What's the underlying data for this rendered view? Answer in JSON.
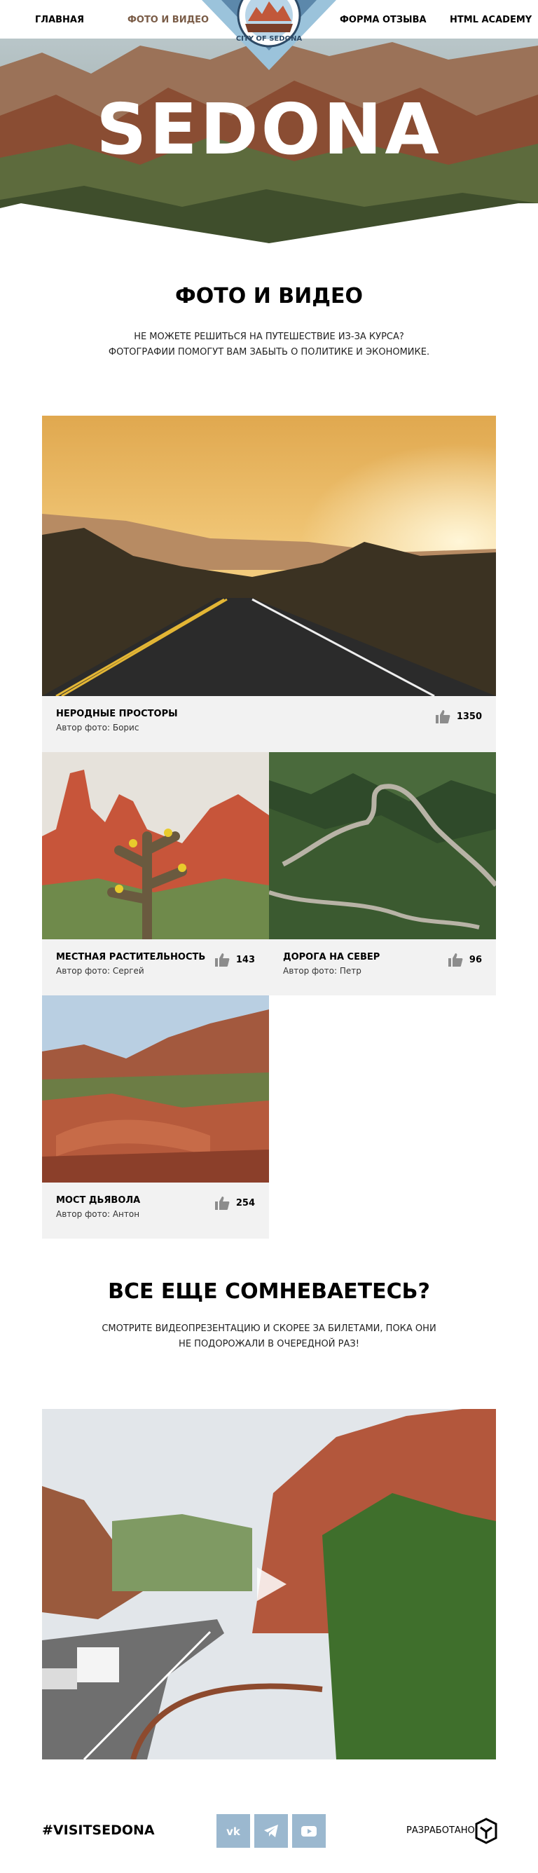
{
  "nav": {
    "main": "ГЛАВНАЯ",
    "photo": "ФОТО И ВИДЕО",
    "form": "ФОРМА ОТЗЫВА",
    "academy": "HTML ACADEMY"
  },
  "logo": {
    "text": "CITY OF SEDONA"
  },
  "hero": {
    "title": "SEDONA"
  },
  "photos_section": {
    "title": "ФОТО И ВИДЕО",
    "text_line1": "НЕ МОЖЕТЕ РЕШИТЬСЯ НА ПУТЕШЕСТВИЕ ИЗ-ЗА КУРСА?",
    "text_line2": "ФОТОГРАФИИ ПОМОГУТ ВАМ ЗАБЫТЬ О ПОЛИТИКЕ И ЭКОНОМИКЕ."
  },
  "gallery": [
    {
      "title": "НЕРОДНЫЕ ПРОСТОРЫ",
      "author": "Автор фото: Борис",
      "likes": "1350",
      "icon": "thumbs-up-icon"
    },
    {
      "title": "МЕСТНАЯ РАСТИТЕЛЬНОСТЬ",
      "author": "Автор фото: Сергей",
      "likes": "143",
      "icon": "thumbs-up-icon"
    },
    {
      "title": "ДОРОГА НА СЕВЕР",
      "author": "Автор фото: Петр",
      "likes": "96",
      "icon": "thumbs-up-icon"
    },
    {
      "title": "МОСТ ДЬЯВОЛА",
      "author": "Автор фото: Антон",
      "likes": "254",
      "icon": "thumbs-up-icon"
    }
  ],
  "video_section": {
    "title": "ВСЕ ЕЩЕ СОМНЕВАЕТЕСЬ?",
    "text_line1": "СМОТРИТЕ ВИДЕОПРЕЗЕНТАЦИЮ И СКОРЕЕ ЗА БИЛЕТАМИ, ПОКА ОНИ",
    "text_line2": "НЕ ПОДОРОЖАЛИ В ОЧЕРЕДНОЙ РАЗ!"
  },
  "footer": {
    "hashtag": "#VISITSEDONA",
    "developed_by": "РАЗРАБОТАНО",
    "social": [
      "vk-icon",
      "telegram-icon",
      "youtube-icon"
    ]
  },
  "colors": {
    "accent_nav": "#7a5c47",
    "social_bg": "#9bb8cf",
    "card_bg": "#f2f2f2"
  }
}
